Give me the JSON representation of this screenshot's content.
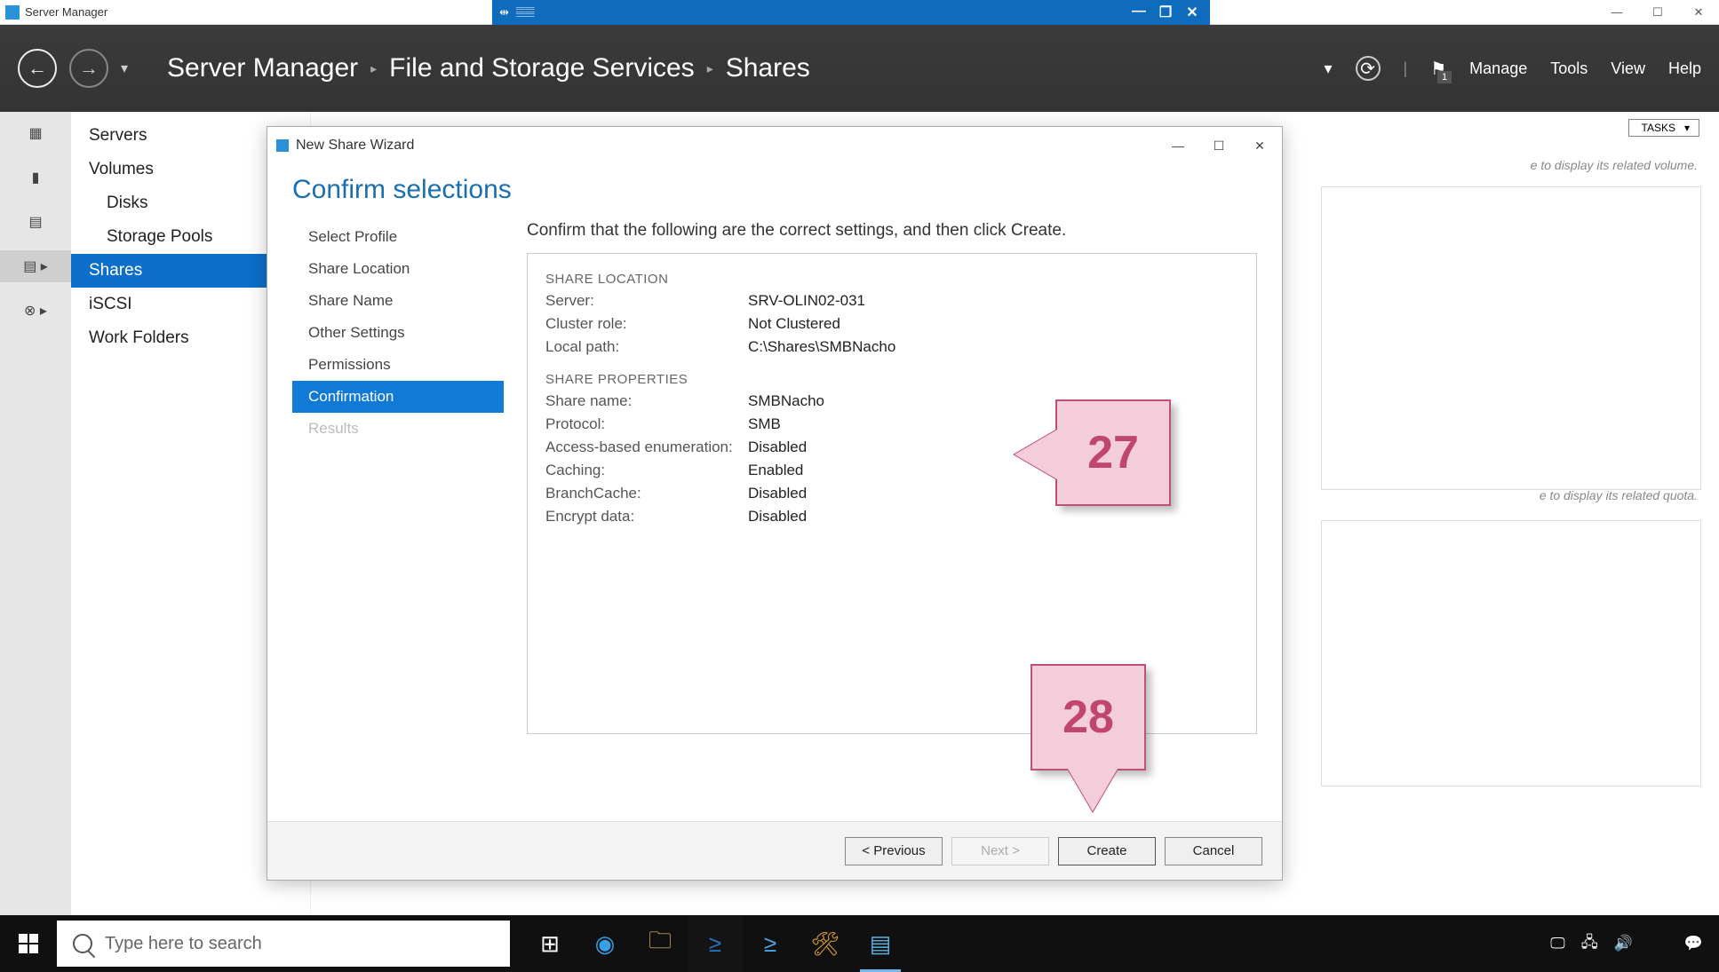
{
  "outer_window": {
    "title": "Server Manager"
  },
  "mdi": {
    "pin_icon": "⇹",
    "signal_icon": "📶"
  },
  "header": {
    "app": "Server Manager",
    "crumb1": "File and Storage Services",
    "crumb2": "Shares",
    "menu_manage": "Manage",
    "menu_tools": "Tools",
    "menu_view": "View",
    "menu_help": "Help",
    "flag_count": "1"
  },
  "sidenav": {
    "servers": "Servers",
    "volumes": "Volumes",
    "disks": "Disks",
    "storage_pools": "Storage Pools",
    "shares": "Shares",
    "iscsi": "iSCSI",
    "work_folders": "Work Folders"
  },
  "content": {
    "tasks": "TASKS",
    "hint_volume": "e to display its related volume.",
    "hint_quota": "e to display its related quota."
  },
  "wizard": {
    "title": "New Share Wizard",
    "heading": "Confirm selections",
    "steps": {
      "select_profile": "Select Profile",
      "share_location": "Share Location",
      "share_name": "Share Name",
      "other_settings": "Other Settings",
      "permissions": "Permissions",
      "confirmation": "Confirmation",
      "results": "Results"
    },
    "desc": "Confirm that the following are the correct settings, and then click Create.",
    "section_location": "SHARE LOCATION",
    "location": {
      "server_k": "Server:",
      "server_v": "SRV-OLIN02-031",
      "cluster_k": "Cluster role:",
      "cluster_v": "Not Clustered",
      "localpath_k": "Local path:",
      "localpath_v": "C:\\Shares\\SMBNacho"
    },
    "section_props": "SHARE PROPERTIES",
    "props": {
      "sharename_k": "Share name:",
      "sharename_v": "SMBNacho",
      "protocol_k": "Protocol:",
      "protocol_v": "SMB",
      "abe_k": "Access-based enumeration:",
      "abe_v": "Disabled",
      "caching_k": "Caching:",
      "caching_v": "Enabled",
      "branch_k": "BranchCache:",
      "branch_v": "Disabled",
      "encrypt_k": "Encrypt data:",
      "encrypt_v": "Disabled"
    },
    "buttons": {
      "previous": "< Previous",
      "next": "Next >",
      "create": "Create",
      "cancel": "Cancel"
    }
  },
  "callouts": {
    "c27": "27",
    "c28": "28"
  },
  "taskbar": {
    "search_placeholder": "Type here to search"
  }
}
